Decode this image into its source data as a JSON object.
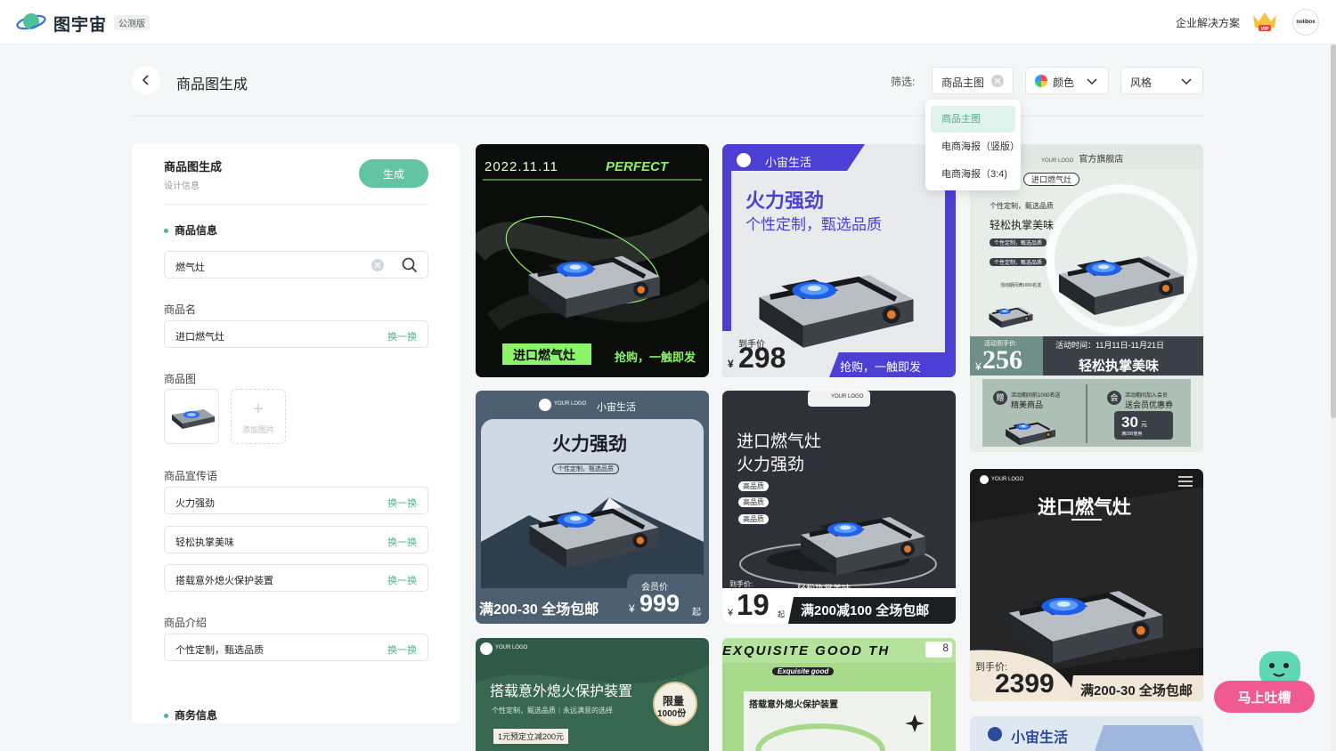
{
  "topbar": {
    "logo_text": "图宇宙",
    "beta_badge": "公测版",
    "enterprise_link": "企业解决方案",
    "vip_label": "VIP",
    "avatar_text": "nolibox"
  },
  "page": {
    "title": "商品图生成",
    "filter_label": "筛选:",
    "filters": {
      "type": {
        "selected": "商品主图"
      },
      "color": {
        "selected": "颜色"
      },
      "style": {
        "selected": "风格"
      }
    },
    "dropdown_options": [
      "商品主图",
      "电商海报（竖版）",
      "电商海报（3:4)"
    ]
  },
  "panel": {
    "title": "商品图生成",
    "subtitle": "设计信息",
    "generate_label": "生成",
    "section_product": "商品信息",
    "search_value": "燃气灶",
    "name_label": "商品名",
    "name_value": "进口燃气灶",
    "swap_label": "换一换",
    "image_label": "商品图",
    "add_image_label": "添加图片",
    "slogan_label": "商品宣传语",
    "slogans": [
      "火力强劲",
      "轻松执掌美味",
      "搭载意外熄火保护装置"
    ],
    "intro_label": "商品介绍",
    "intro_value": "个性定制，甄选品质",
    "section_business": "商务信息"
  },
  "cards": {
    "c1": {
      "date": "2022.11.11",
      "brand": "PERFECT",
      "name": "进口燃气灶",
      "slogan": "抢购，一触即发"
    },
    "c2": {
      "brand": "小宙生活",
      "title": "火力强劲",
      "subtitle": "个性定制，甄选品质",
      "price_label": "到手价",
      "currency": "¥",
      "price": "298",
      "slogan": "抢购，一触即发"
    },
    "c3": {
      "logo": "YOUR LOGO",
      "store": "官方旗舰店",
      "search_tag": "进口燃气灶",
      "line1": "个性定制，甄选品质",
      "title": "轻松执掌美味",
      "tag": "个性定制，甄选品质",
      "small_tag": "活动期间满1000名送",
      "price_label": "活动到手价:",
      "activity_time": "活动时间：11月11日-11月21日",
      "currency": "¥",
      "price": "256",
      "slogan": "轻松执掌美味",
      "gift_title": "活动期间前1000名送",
      "gift_name": "精美商品",
      "coupon_title": "活动期间加入会员",
      "coupon_name": "送会员优惠券",
      "coupon_value": "30",
      "coupon_unit": "元",
      "coupon_cond": "满200使用",
      "gift_icon": "赠",
      "coupon_icon": "会"
    },
    "c4": {
      "logo": "YOUR LOGO",
      "brand": "小宙生活",
      "title": "火力强劲",
      "tag": "个性定制，甄选品质",
      "promo": "满200-30 全场包邮",
      "member_label": "会员价",
      "currency": "¥",
      "price": "999",
      "suffix": "起"
    },
    "c5": {
      "logo": "YOUR LOGO",
      "title1": "进口燃气灶",
      "title2": "火力强劲",
      "tags": [
        "高品质",
        "高品质",
        "高品质"
      ],
      "price_label": "到手价:",
      "currency": "¥",
      "price": "19",
      "suffix": "起",
      "slogan": "轻松执掌美味",
      "promo": "满200减100 全场包邮"
    },
    "c6": {
      "logo": "YOUR LOGO",
      "title": "进口燃气灶",
      "price_label": "到手价:",
      "price": "2399",
      "promo": "满200-30 全场包邮"
    },
    "c7": {
      "logo": "YOUR LOGO",
      "title": "搭载意外熄火保护装置",
      "sub": "个性定制，甄选品质｜永远满意的选择",
      "badge1": "限量",
      "badge2": "1000份",
      "deal": "1元预定立减200元"
    },
    "c8": {
      "marquee": "EXQUISITE GOOD TH",
      "counter": "8",
      "tag": "Exquisite good",
      "title": "搭载意外熄火保护装置"
    },
    "c9": {
      "brand": "小宙生活"
    }
  },
  "feedback": {
    "label": "马上吐槽"
  },
  "colors": {
    "accent": "#62c4a2",
    "accent_text": "#4db38f",
    "feedback": "#f05a8f"
  }
}
